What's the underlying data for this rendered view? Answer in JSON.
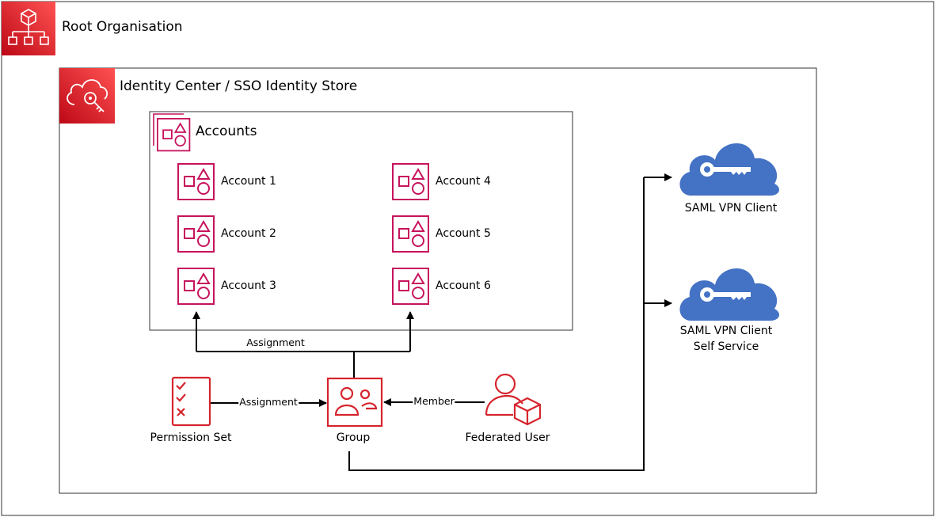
{
  "root": {
    "title": "Root Organisation",
    "icon": "organization-icon"
  },
  "identity_store": {
    "title": "Identity Center / SSO Identity Store",
    "icon": "cloud-key-icon"
  },
  "accounts": {
    "title": "Accounts",
    "icon": "accounts-group-icon",
    "items": [
      "Account 1",
      "Account 2",
      "Account 3",
      "Account 4",
      "Account 5",
      "Account 6"
    ]
  },
  "nodes": {
    "permission_set": "Permission Set",
    "group": "Group",
    "federated_user": "Federated User",
    "saml_vpn_client": "SAML VPN Client",
    "saml_vpn_self_service_line1": "SAML VPN Client",
    "saml_vpn_self_service_line2": "Self Service"
  },
  "edges": {
    "group_to_accounts": "Assignment",
    "permset_to_group": "Assignment",
    "user_to_group": "Member"
  },
  "colors": {
    "aws_red": "#D6242D",
    "account_pink": "#C7135C",
    "cloud_blue": "#4472C4",
    "line": "#000000"
  }
}
